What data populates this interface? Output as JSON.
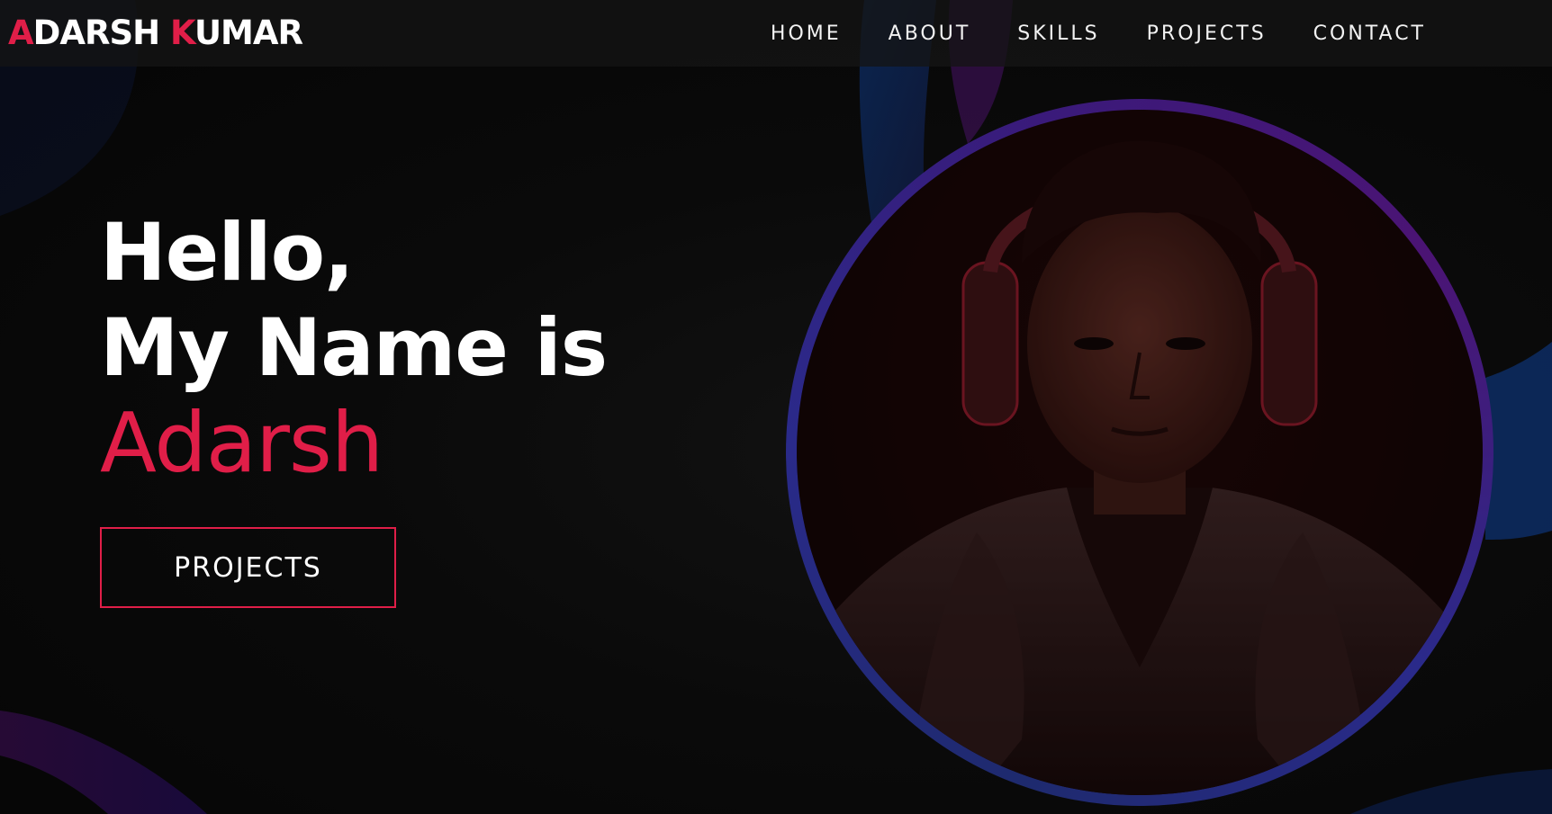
{
  "header": {
    "logo": {
      "first_initial": "A",
      "first_rest": "DARSH",
      "last_initial": "K",
      "last_rest": "UMAR"
    },
    "nav": [
      {
        "label": "HOME"
      },
      {
        "label": "ABOUT"
      },
      {
        "label": "SKILLS"
      },
      {
        "label": "PROJECTS"
      },
      {
        "label": "CONTACT"
      }
    ]
  },
  "hero": {
    "greeting": "Hello,",
    "intro": "My Name is",
    "name": "Adarsh",
    "cta_label": "PROJECTS"
  },
  "colors": {
    "accent": "#e01e48",
    "background": "#070707",
    "ring": "#2a2a8a"
  }
}
